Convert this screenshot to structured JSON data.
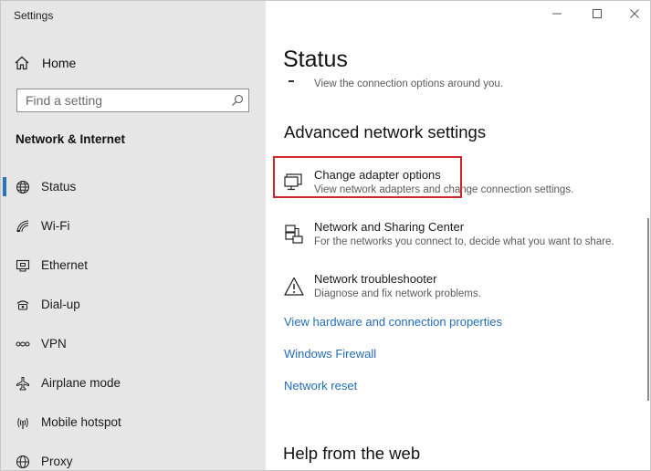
{
  "window": {
    "title": "Settings"
  },
  "caption_buttons": {
    "minimize": "minimize-icon",
    "maximize": "maximize-icon",
    "close": "close-icon"
  },
  "sidebar": {
    "home_label": "Home",
    "search": {
      "placeholder": "Find a setting",
      "value": ""
    },
    "section_heading": "Network & Internet",
    "items": [
      {
        "label": "Status",
        "icon": "globe-icon",
        "active": true
      },
      {
        "label": "Wi-Fi",
        "icon": "wifi-icon",
        "active": false
      },
      {
        "label": "Ethernet",
        "icon": "ethernet-icon",
        "active": false
      },
      {
        "label": "Dial-up",
        "icon": "phone-icon",
        "active": false
      },
      {
        "label": "VPN",
        "icon": "vpn-icon",
        "active": false
      },
      {
        "label": "Airplane mode",
        "icon": "airplane-icon",
        "active": false
      },
      {
        "label": "Mobile hotspot",
        "icon": "hotspot-icon",
        "active": false
      },
      {
        "label": "Proxy",
        "icon": "globe-icon",
        "active": false
      }
    ]
  },
  "main": {
    "title": "Status",
    "status_subtext": "View the connection options around you.",
    "advanced_heading": "Advanced network settings",
    "options": [
      {
        "title": "Change adapter options",
        "description": "View network adapters and change connection settings.",
        "icon": "monitor-icon"
      },
      {
        "title": "Network and Sharing Center",
        "description": "For the networks you connect to, decide what you want to share.",
        "icon": "network-sharing-icon"
      },
      {
        "title": "Network troubleshooter",
        "description": "Diagnose and fix network problems.",
        "icon": "warning-icon"
      }
    ],
    "links": [
      "View hardware and connection properties",
      "Windows Firewall",
      "Network reset"
    ],
    "help_heading": "Help from the web"
  },
  "colors": {
    "sidebar_bg": "#e6e6e6",
    "accent": "#2b73c7",
    "link": "#1f6cc0",
    "highlight": "#d0252a"
  }
}
